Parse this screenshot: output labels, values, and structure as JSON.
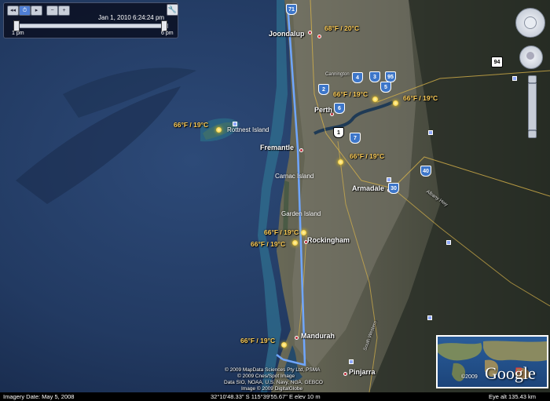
{
  "time": {
    "display": "Jan  1, 2010   6:24:24 pm",
    "range_start": "1 pm",
    "range_end": "6 pm",
    "position": 0.97
  },
  "cities": [
    {
      "name": "Joondalup"
    },
    {
      "name": "Perth"
    },
    {
      "name": "Fremantle"
    },
    {
      "name": "Armadale"
    },
    {
      "name": "Rockingham"
    },
    {
      "name": "Mandurah"
    },
    {
      "name": "Pinjarra"
    }
  ],
  "islands": [
    "Rottnest Island",
    "Carnac Island",
    "Garden Island"
  ],
  "temperatures": [
    "68°F / 20°C",
    "66°F / 19°C",
    "66°F / 19°C",
    "66°F / 19°C",
    "66°F / 19°C",
    "66°F / 19°C",
    "66°F / 19°C",
    "66°F / 19°C"
  ],
  "shields": [
    "71",
    "4",
    "3",
    "95",
    "5",
    "2",
    "6",
    "1",
    "7",
    "40",
    "30",
    "94"
  ],
  "roads": [
    "Cannington",
    "Albany Hwy",
    "South Western"
  ],
  "copyright": [
    "© 2009 MapData Sciences Pty Ltd, PSMA",
    "© 2009 Cnes/Spot Image",
    "Data SIO, NOAA, U.S. Navy, NGA, GEBCO",
    "Image © 2009 DigitalGlobe"
  ],
  "overview": {
    "copyright": "©2009",
    "logo": "Google"
  },
  "status": {
    "imagery_date": "Imagery Date: May 5, 2008",
    "coords": "32°10'48.33\" S     115°39'55.67\" E   elev   10 m",
    "eye_alt": "Eye alt   135.43 km"
  },
  "colors": {
    "ocean": "#223a62",
    "land": "#4b4a3c",
    "path": "#6fa6ff",
    "temp": "#ffcf5a"
  }
}
